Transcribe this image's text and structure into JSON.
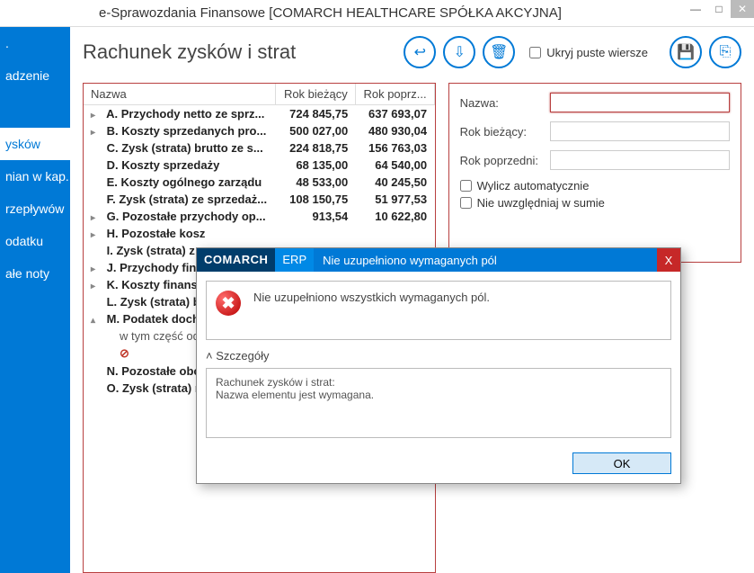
{
  "window": {
    "title": "e-Sprawozdania Finansowe  [COMARCH HEALTHCARE SPÓŁKA AKCYJNA]"
  },
  "sidebar": {
    "items": [
      {
        "label": "."
      },
      {
        "label": "adzenie"
      },
      {
        "label": "ysków"
      },
      {
        "label": "nian w kap."
      },
      {
        "label": "rzepływów"
      },
      {
        "label": "odatku"
      },
      {
        "label": "ałe noty"
      }
    ],
    "active_index": 2
  },
  "header": {
    "title": "Rachunek zysków i strat",
    "hide_empty_rows": "Ukryj puste wiersze"
  },
  "icons": {
    "back": "↩",
    "down": "⇩",
    "trash": "🗑",
    "save": "💾",
    "export": "⎘"
  },
  "table": {
    "columns": [
      "Nazwa",
      "Rok bieżący",
      "Rok poprz..."
    ],
    "rows": [
      {
        "letter": "A.",
        "name": "Przychody netto ze sprz...",
        "cur": "724 845,75",
        "prev": "637 693,07",
        "bold": true,
        "exp": "▸"
      },
      {
        "letter": "B.",
        "name": "Koszty sprzedanych pro...",
        "cur": "500 027,00",
        "prev": "480 930,04",
        "bold": true,
        "exp": "▸"
      },
      {
        "letter": "C.",
        "name": "Zysk (strata) brutto ze s...",
        "cur": "224 818,75",
        "prev": "156 763,03",
        "bold": true,
        "exp": ""
      },
      {
        "letter": "D.",
        "name": "Koszty sprzedaży",
        "cur": "68 135,00",
        "prev": "64 540,00",
        "bold": true,
        "exp": ""
      },
      {
        "letter": "E.",
        "name": "Koszty ogólnego zarządu",
        "cur": "48 533,00",
        "prev": "40 245,50",
        "bold": true,
        "exp": ""
      },
      {
        "letter": "F.",
        "name": "Zysk (strata) ze sprzedaż...",
        "cur": "108 150,75",
        "prev": "51 977,53",
        "bold": true,
        "exp": ""
      },
      {
        "letter": "G.",
        "name": "Pozostałe przychody op...",
        "cur": "913,54",
        "prev": "10 622,80",
        "bold": true,
        "exp": "▸"
      },
      {
        "letter": "H.",
        "name": "Pozostałe kosz",
        "cur": "",
        "prev": "",
        "bold": true,
        "exp": "▸"
      },
      {
        "letter": "I.",
        "name": "Zysk (strata) z",
        "cur": "",
        "prev": "",
        "bold": true,
        "exp": ""
      },
      {
        "letter": "J.",
        "name": "Przychody fina",
        "cur": "",
        "prev": "",
        "bold": true,
        "exp": "▸"
      },
      {
        "letter": "K.",
        "name": "Koszty finanso",
        "cur": "",
        "prev": "",
        "bold": true,
        "exp": "▸"
      },
      {
        "letter": "L.",
        "name": "Zysk (strata) b",
        "cur": "",
        "prev": "",
        "bold": true,
        "exp": ""
      },
      {
        "letter": "M.",
        "name": "Podatek doch",
        "cur": "",
        "prev": "",
        "bold": true,
        "exp": "▴"
      },
      {
        "letter": "",
        "name": "w tym część od",
        "cur": "",
        "prev": "",
        "bold": false,
        "sub": true
      },
      {
        "letter": "",
        "name": "⊘",
        "cur": "",
        "prev": "",
        "bold": false,
        "err": true
      },
      {
        "letter": "N.",
        "name": "Pozostałe obo",
        "cur": "",
        "prev": "",
        "bold": true,
        "exp": ""
      },
      {
        "letter": "O.",
        "name": "Zysk (strata) n",
        "cur": "",
        "prev": "",
        "bold": true,
        "exp": ""
      }
    ]
  },
  "form": {
    "name_label": "Nazwa:",
    "name_value": "",
    "cur_label": "Rok bieżący:",
    "cur_value": "",
    "prev_label": "Rok poprzedni:",
    "prev_value": "",
    "auto_calc": "Wylicz automatycznie",
    "exclude_sum": "Nie uwzględniaj w sumie"
  },
  "modal": {
    "brand": "COMARCH",
    "erp": "ERP",
    "title": "Nie uzupełniono wymaganych pól",
    "message": "Nie uzupełniono wszystkich wymaganych pól.",
    "details_label": "Szczegóły",
    "details_text_1": "Rachunek zysków i strat:",
    "details_text_2": "Nazwa elementu jest wymagana.",
    "ok": "OK",
    "close": "X"
  }
}
